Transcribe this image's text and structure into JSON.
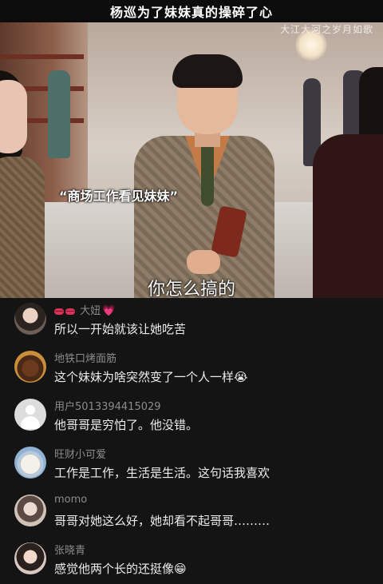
{
  "title": "杨巡为了妹妹真的操碎了心",
  "video": {
    "watermark": "大江大河之岁月如歌",
    "quote_caption": "“商场工作看见妹妹”",
    "subtitle": "你怎么搞的"
  },
  "comments": [
    {
      "username": "大妞",
      "text": "所以一开始就该让她吃苦",
      "emoji": ""
    },
    {
      "username": "地铁口烤面筋",
      "text": "这个妹妹为啥突然变了一个人一样",
      "emoji": "😭"
    },
    {
      "username": "用户5013394415029",
      "text": "他哥哥是穷怕了。他没错。",
      "emoji": ""
    },
    {
      "username": "旺财小可爱",
      "text": "工作是工作，生活是生活。这句话我喜欢",
      "emoji": ""
    },
    {
      "username": "momo",
      "text": "哥哥对她这么好，她却看不起哥哥………",
      "emoji": ""
    },
    {
      "username": "张晓青",
      "text": "感觉他两个长的还挺像",
      "emoji": "😁"
    }
  ],
  "icons": {
    "lips": "lips-emoji-icon",
    "heart": "heart-emoji-icon",
    "default_avatar": "default-user-icon"
  }
}
